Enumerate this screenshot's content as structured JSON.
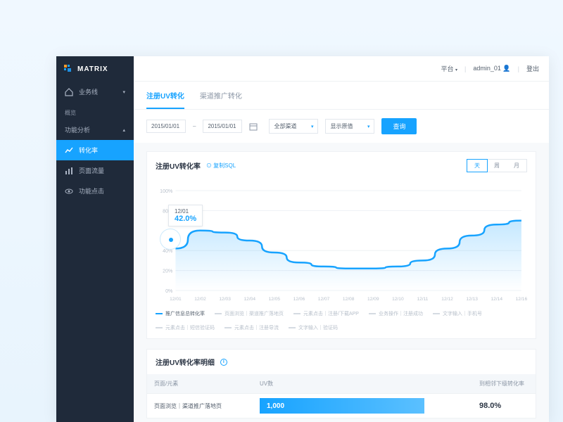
{
  "brand": {
    "name": "MATRIX"
  },
  "topbar": {
    "platform": "平台",
    "user": "admin_01",
    "logout": "登出"
  },
  "sidebar": {
    "items": [
      {
        "label": "业务线",
        "type": "parent"
      },
      {
        "label": "概览",
        "type": "section"
      },
      {
        "label": "功能分析",
        "type": "parent"
      },
      {
        "label": "转化率",
        "type": "item",
        "active": true
      },
      {
        "label": "页面流量",
        "type": "item"
      },
      {
        "label": "功能点击",
        "type": "item"
      }
    ]
  },
  "tabs": [
    {
      "label": "注册UV转化",
      "active": true
    },
    {
      "label": "渠道推广转化",
      "active": false
    }
  ],
  "filters": {
    "date_from": "2015/01/01",
    "date_to": "2015/01/01",
    "select1": "全部渠道",
    "select2": "显示原值",
    "query_btn": "查询"
  },
  "chart_card": {
    "title": "注册UV转化率",
    "copy_sql": "复制SQL",
    "periods": {
      "day": "天",
      "week": "周",
      "month": "月",
      "active": "day"
    },
    "tooltip": {
      "date": "12/01",
      "value": "42.0%"
    }
  },
  "chart_data": {
    "type": "line",
    "title": "注册UV转化率",
    "xlabel": "",
    "ylabel": "",
    "ylim": [
      0,
      100
    ],
    "yticks": [
      0,
      20,
      40,
      80,
      100
    ],
    "categories": [
      "12/01",
      "12/02",
      "12/03",
      "12/04",
      "12/05",
      "12/06",
      "12/07",
      "12/08",
      "12/09",
      "12/10",
      "12/11",
      "12/12",
      "12/13",
      "12/14",
      "12/16"
    ],
    "series": [
      {
        "name": "推广信息总转化率",
        "values": [
          42,
          60,
          58,
          50,
          38,
          28,
          24,
          22,
          22,
          24,
          30,
          42,
          55,
          66,
          70
        ]
      }
    ],
    "legend": {
      "active": "推广信息总转化率",
      "items": [
        "推广信息总转化率",
        "页面浏览｜渠道推广落地页",
        "元素点击｜注册/下载APP",
        "业务操作｜注册成功",
        "文字输入｜手机号",
        "元素点击｜短信验证码",
        "元素点击｜注册导流",
        "文字输入｜验证码"
      ]
    }
  },
  "detail_card": {
    "title": "注册UV转化率明细",
    "columns": {
      "a": "页面/元素",
      "b": "UV数",
      "c": "到相邻下级转化率"
    },
    "rows": [
      {
        "label": "页面浏览｜渠道推广落地页",
        "uv": "1,000",
        "rate": "98.0%"
      }
    ]
  }
}
